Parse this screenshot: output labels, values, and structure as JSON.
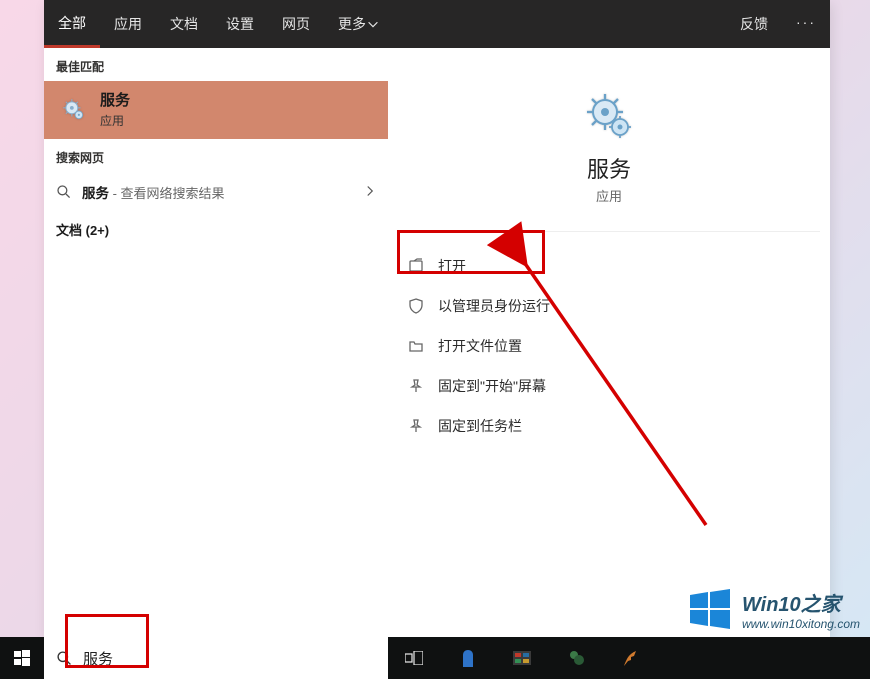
{
  "tabs": {
    "all": "全部",
    "apps": "应用",
    "docs": "文档",
    "settings": "设置",
    "web": "网页",
    "more": "更多",
    "feedback": "反馈"
  },
  "left": {
    "best_match_label": "最佳匹配",
    "best_match": {
      "title": "服务",
      "sub": "应用"
    },
    "search_web_label": "搜索网页",
    "web_row": {
      "term": "服务",
      "hint": " - 查看网络搜索结果"
    },
    "docs_label": "文档 (2+)"
  },
  "detail": {
    "title": "服务",
    "sub": "应用",
    "actions": {
      "open": "打开",
      "run_admin": "以管理员身份运行",
      "open_location": "打开文件位置",
      "pin_start": "固定到\"开始\"屏幕",
      "pin_taskbar": "固定到任务栏"
    }
  },
  "search": {
    "value": "服务"
  },
  "watermark": {
    "brand1": "Win10",
    "brand2": "之家",
    "url": "www.win10xitong.com"
  }
}
